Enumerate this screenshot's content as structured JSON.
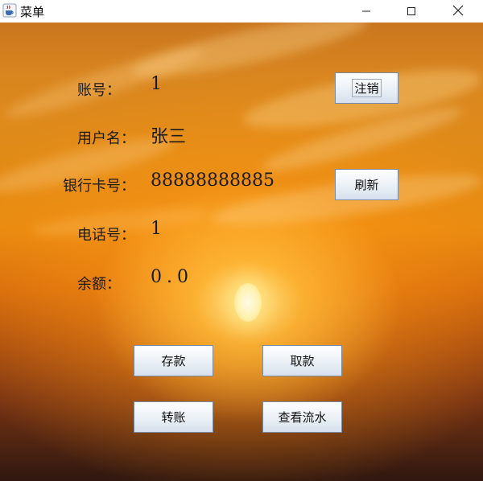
{
  "window": {
    "title": "菜单",
    "icon": "java-coffee-cup-icon"
  },
  "controls": {
    "minimize_icon": "minimize-icon",
    "maximize_icon": "maximize-icon",
    "close_icon": "close-icon"
  },
  "fields": {
    "account": {
      "label": "账号：",
      "value": "1"
    },
    "username": {
      "label": "用户名：",
      "value": "张三"
    },
    "card_number": {
      "label": "银行卡号：",
      "value": "88888888885"
    },
    "phone": {
      "label": "电话号：",
      "value": "1"
    },
    "balance": {
      "label": "余额：",
      "value": "0.0"
    }
  },
  "buttons": {
    "logout": "注销",
    "refresh": "刷新",
    "deposit": "存款",
    "withdraw": "取款",
    "transfer": "转账",
    "view_transactions": "查看流水"
  }
}
